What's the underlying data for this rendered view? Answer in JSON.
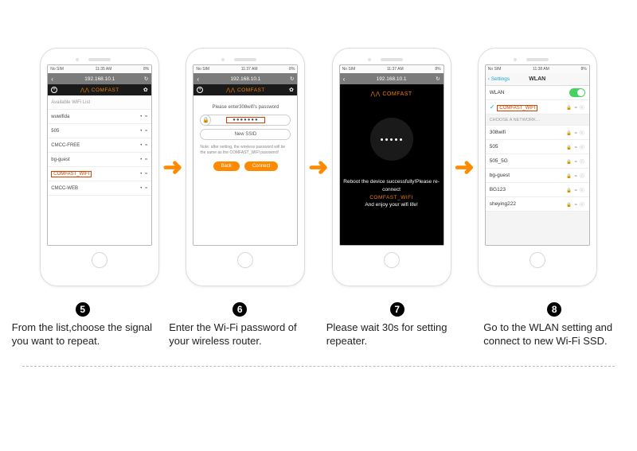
{
  "status": {
    "nosim": "No SIM",
    "wifi": "≈",
    "times": [
      "11:35 AM",
      "11:37 AM",
      "11:37 AM",
      "11:38 AM"
    ],
    "batt": "8%"
  },
  "url": {
    "ip": "192.168.10.1",
    "refresh": "↻",
    "back": "‹"
  },
  "brand": {
    "logo": "⋀⋀ COMFAST",
    "plus": "+",
    "gear": "✿"
  },
  "screen1": {
    "header": "Available WiFi List",
    "items": [
      "wuwifida",
      "505",
      "CMCC-FREE",
      "bg-guest",
      "COMFAST_WIFI",
      "CMCC-WEB"
    ],
    "sig": "• ≈"
  },
  "screen2": {
    "prompt": "Please enter308wifi's password",
    "pwmask": "●●●●●●●",
    "ssidfield": "New SSID",
    "note": "Note: after setting, the wireless password will be the same as the COMFAST_WIFI password!",
    "back": "Back",
    "connect": "Connect"
  },
  "screen3": {
    "line1": "Reboot the device successfully!Please re-connect",
    "line2": "COMFAST_WIFI",
    "line3": "And enjoy your wifi life!"
  },
  "screen4": {
    "backlabel": "Settings",
    "title": "WLAN",
    "wlanrow": "WLAN",
    "connected": "COMFAST_WIFI",
    "choose": "CHOOSE A NETWORK…",
    "nets": [
      "308wifi",
      "505",
      "505_5G",
      "bg-guest",
      "BG123",
      "sheying222"
    ],
    "neticons": "🔒 ≈ ⓘ"
  },
  "captions": [
    {
      "num": "5",
      "text": "From the list,choose the signal you want to repeat."
    },
    {
      "num": "6",
      "text": "Enter the Wi-Fi password of your wireless router."
    },
    {
      "num": "7",
      "text": "Please wait 30s for setting repeater."
    },
    {
      "num": "8",
      "text": "Go to the WLAN setting and connect to new Wi-Fi SSD."
    }
  ],
  "arrow_glyph": "➜"
}
